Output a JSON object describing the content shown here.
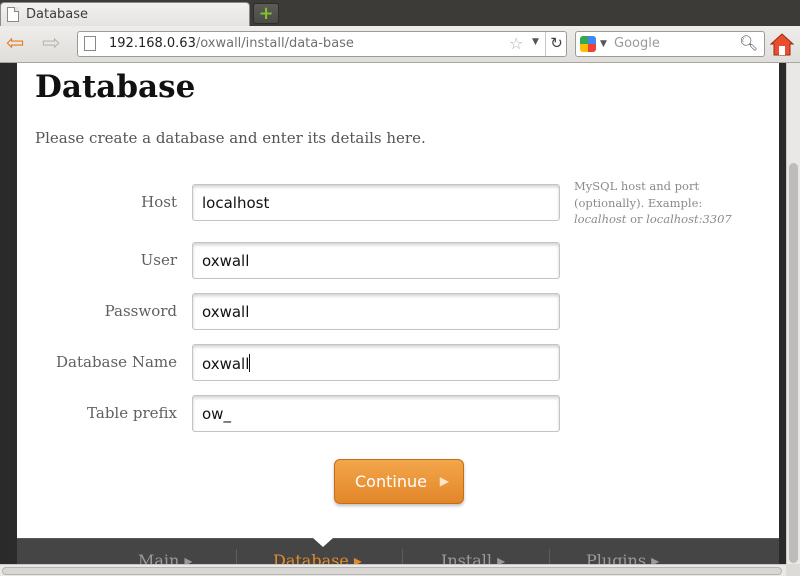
{
  "browser": {
    "tab_title": "Database",
    "new_tab_label": "+",
    "url_host": "192.168.0.63",
    "url_path": "/oxwall/install/data-base",
    "search_placeholder": "Google"
  },
  "page": {
    "heading": "Database",
    "intro": "Please create a database and enter its details here."
  },
  "form": {
    "host_label": "Host",
    "host_value": "localhost",
    "user_label": "User",
    "user_value": "oxwall",
    "password_label": "Password",
    "password_value": "oxwall",
    "dbname_label": "Database Name",
    "dbname_value": "oxwall",
    "prefix_label": "Table prefix",
    "prefix_value": "ow_",
    "hint_line1": "MySQL host and port (optionally). Example:",
    "hint_example1": "localhost",
    "hint_or": " or ",
    "hint_example2": "localhost:3307",
    "continue_label": "Continue"
  },
  "steps": [
    {
      "label": "Main",
      "active": false
    },
    {
      "label": "Database",
      "active": true
    },
    {
      "label": "Install",
      "active": false
    },
    {
      "label": "Plugins",
      "active": false
    }
  ],
  "colors": {
    "accent": "#e38a2d",
    "footer_bg": "#454545"
  }
}
